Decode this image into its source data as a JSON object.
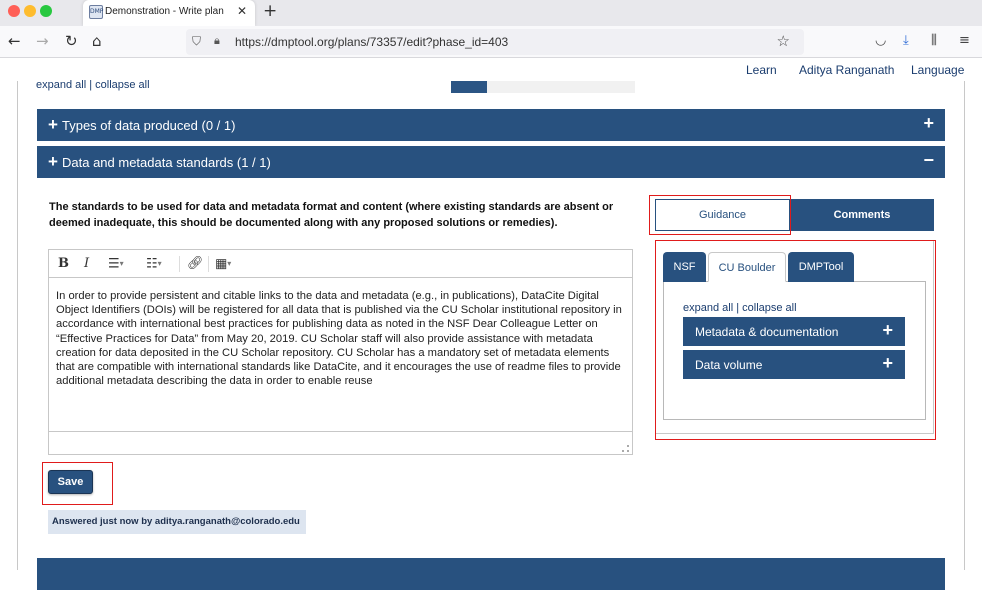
{
  "browser": {
    "tab_title": "Demonstration - Write plan",
    "favicon_text": "DMP",
    "url": "https://dmptool.org/plans/73357/edit?phase_id=403"
  },
  "topnav": {
    "learn": "Learn",
    "user": "Aditya Ranganath",
    "language": "Language"
  },
  "top_controls": {
    "expand_all": "expand all",
    "separator": "|",
    "collapse_all": "collapse all"
  },
  "sections": [
    {
      "title": "Types of data produced (0 / 1)",
      "state": "collapsed",
      "toggle": "+"
    },
    {
      "title": "Data and metadata standards (1 / 1)",
      "state": "expanded",
      "toggle": "−"
    }
  ],
  "question": "The standards to be used for data and metadata format and content (where existing standards are absent or deemed inadequate, this should be documented along with any proposed solutions or remedies).",
  "editor": {
    "answer": "In order to provide persistent and citable links to the data and metadata (e.g., in publications), DataCite Digital Object Identifiers (DOIs) will be registered for all data that is published via the CU Scholar institutional repository in accordance with international best practices for publishing data as noted in the NSF Dear Colleague Letter on “Effective Practices for Data” from May 20, 2019. CU Scholar staff will also provide assistance with metadata creation for data deposited in the CU Scholar repository. CU Scholar has a mandatory set of metadata elements that are compatible with international standards like DataCite, and it encourages the use of readme files to provide additional metadata describing the data in order to enable reuse"
  },
  "save_label": "Save",
  "answered_text": "Answered just now by aditya.ranganath@colorado.edu",
  "side_tabs": {
    "guidance": "Guidance",
    "comments": "Comments"
  },
  "guidance_tabs": [
    "NSF",
    "CU Boulder",
    "DMPTool"
  ],
  "guidance_controls": {
    "expand_all": "expand all",
    "separator": "|",
    "collapse_all": "collapse all"
  },
  "guidance_items": [
    {
      "title": "Metadata & documentation",
      "toggle": "+"
    },
    {
      "title": "Data volume",
      "toggle": "+"
    }
  ],
  "colors": {
    "primary": "#28517f",
    "highlight": "#e01b1b",
    "answered_bg": "#dde5f0"
  }
}
